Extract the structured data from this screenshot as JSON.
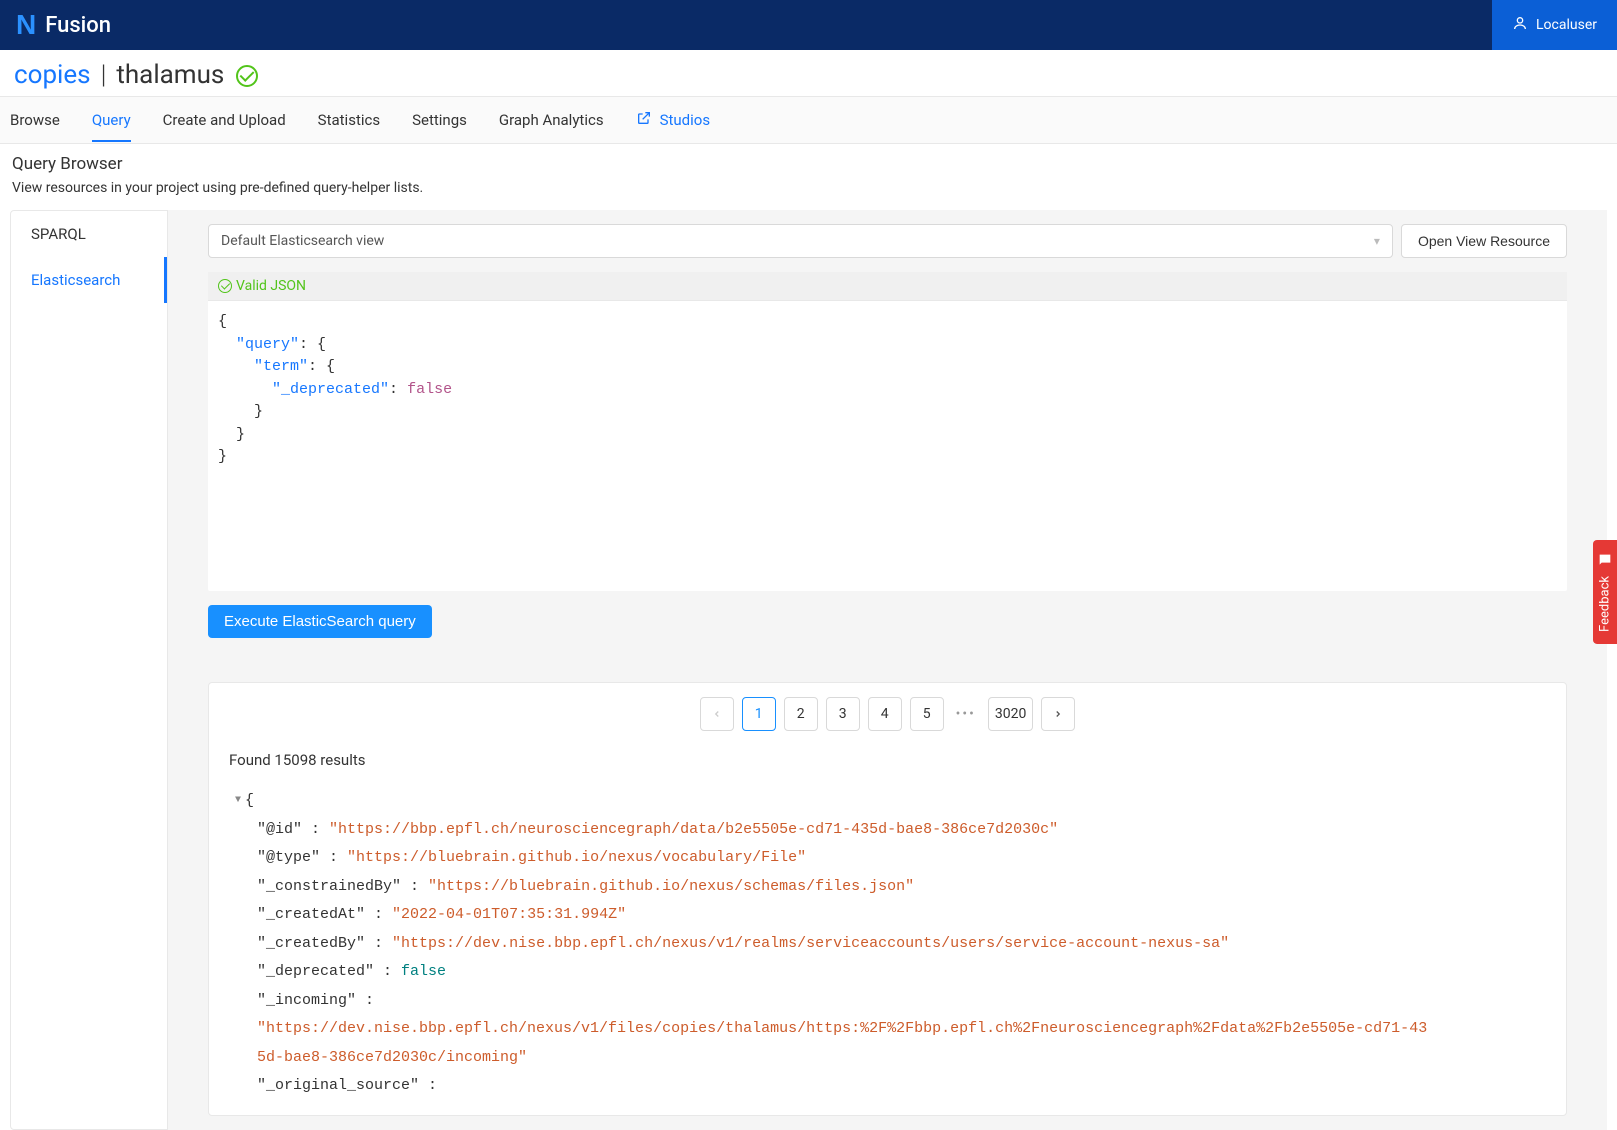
{
  "header": {
    "app_name": "Fusion",
    "user": "Localuser"
  },
  "breadcrumb": {
    "org": "copies",
    "project": "thalamus"
  },
  "tabs": [
    "Browse",
    "Query",
    "Create and Upload",
    "Statistics",
    "Settings",
    "Graph Analytics",
    "Studios"
  ],
  "active_tab": "Query",
  "page": {
    "title": "Query Browser",
    "subtitle": "View resources in your project using pre-defined query-helper lists."
  },
  "sidebar": {
    "items": [
      "SPARQL",
      "Elasticsearch"
    ],
    "active": "Elasticsearch"
  },
  "view_select": {
    "label": "Default Elasticsearch view"
  },
  "buttons": {
    "open_view": "Open View Resource",
    "execute": "Execute ElasticSearch query"
  },
  "editor": {
    "status": "Valid JSON",
    "query_keys": {
      "query": "\"query\"",
      "term": "\"term\"",
      "deprecated": "\"_deprecated\"",
      "val": "false"
    }
  },
  "pagination": {
    "pages": [
      "1",
      "2",
      "3",
      "4",
      "5"
    ],
    "last": "3020",
    "active": "1"
  },
  "results": {
    "found_text": "Found 15098 results",
    "row": {
      "id_key": "\"@id\"",
      "id_val": "\"https://bbp.epfl.ch/neurosciencegraph/data/b2e5505e-cd71-435d-bae8-386ce7d2030c\"",
      "type_key": "\"@type\"",
      "type_val": "\"https://bluebrain.github.io/nexus/vocabulary/File\"",
      "constr_key": "\"_constrainedBy\"",
      "constr_val": "\"https://bluebrain.github.io/nexus/schemas/files.json\"",
      "created_key": "\"_createdAt\"",
      "created_val": "\"2022-04-01T07:35:31.994Z\"",
      "createdby_key": "\"_createdBy\"",
      "createdby_val": "\"https://dev.nise.bbp.epfl.ch/nexus/v1/realms/serviceaccounts/users/service-account-nexus-sa\"",
      "dep_key": "\"_deprecated\"",
      "dep_val": "false",
      "inc_key": "\"_incoming\"",
      "inc_val": "\"https://dev.nise.bbp.epfl.ch/nexus/v1/files/copies/thalamus/https:%2F%2Fbbp.epfl.ch%2Fneurosciencegraph%2Fdata%2Fb2e5505e-cd71-435d-bae8-386ce7d2030c/incoming\"",
      "orig_key": "\"_original_source\""
    }
  },
  "feedback": "Feedback"
}
